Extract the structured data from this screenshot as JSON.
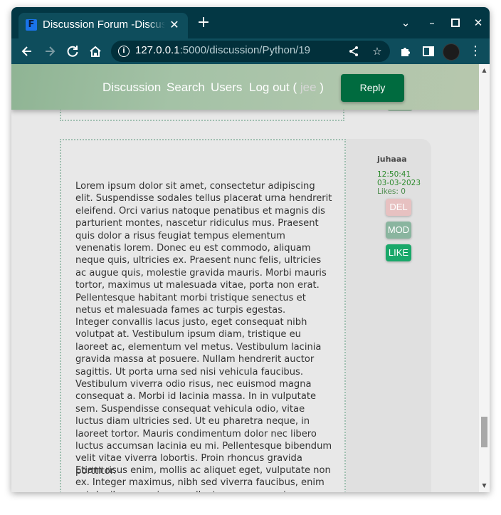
{
  "browser": {
    "tab_title": "Discussion Forum -Discussion",
    "tab_favicon_letter": "F",
    "url_host": "127.0.0.1",
    "url_rest": ":5000/discussion/Python/19",
    "icons": [
      "back-icon",
      "forward-icon",
      "reload-icon",
      "home-icon",
      "site-info-icon",
      "share-icon",
      "bookmark-star-icon",
      "extensions-icon",
      "side-panel-icon",
      "profile-avatar",
      "menu-icon"
    ]
  },
  "header": {
    "nav": {
      "discussion": "Discussion",
      "search": "Search",
      "users": "Users",
      "logout_prefix": "Log out (",
      "user": " jee ",
      "logout_suffix": ")"
    },
    "reply_label": "Reply"
  },
  "post": {
    "author": "juhaaa",
    "time": "12:50:41",
    "date": "03-03-2023",
    "likes": "Likes: 0",
    "buttons": {
      "del": "DEL",
      "mod": "MOD",
      "like": "LIKE"
    },
    "paragraphs": [
      "Lorem ipsum dolor sit amet, consectetur adipiscing elit. Suspendisse sodales tellus placerat urna hendrerit eleifend. Orci varius natoque penatibus et magnis dis parturient montes, nascetur ridiculus mus. Praesent quis dolor a risus feugiat tempus elementum venenatis lorem. Donec eu est commodo, aliquam neque quis, ultricies ex. Praesent nunc felis, ultricies ac augue quis, molestie gravida mauris. Morbi mauris tortor, maximus ut malesuada vitae, porta non erat. Pellentesque habitant morbi tristique senectus et netus et malesuada fames ac turpis egestas.",
      "Integer convallis lacus justo, eget consequat nibh volutpat at. Vestibulum ipsum diam, tristique eu laoreet ac, elementum vel metus. Vestibulum lacinia gravida massa at posuere. Nullam hendrerit auctor sagittis. Ut porta urna sed nisi vehicula faucibus. Vestibulum viverra odio risus, nec euismod magna consequat a. Morbi id lacinia massa. In in vulputate sem. Suspendisse consequat vehicula odio, vitae luctus diam ultricies sed. Ut eu pharetra neque, in laoreet tortor. Mauris condimentum dolor nec libero luctus accumsan lacinia eu mi. Pellentesque bibendum velit vitae viverra lobortis. Proin rhoncus gravida porttitor.",
      "Etiam risus enim, mollis ac aliquet eget, vulputate non ex. Integer maximus, nibh sed viverra faucibus, enim est dapibus mauris, ac pellentesque neque risus nec turpis. In"
    ]
  },
  "colors": {
    "tab_strip": "#033744",
    "toolbar": "#0e4d5c",
    "reply_button": "#006b3f",
    "like_button": "#1aa86a",
    "mod_button": "#8ab59f",
    "del_button": "#e7c1c1"
  }
}
